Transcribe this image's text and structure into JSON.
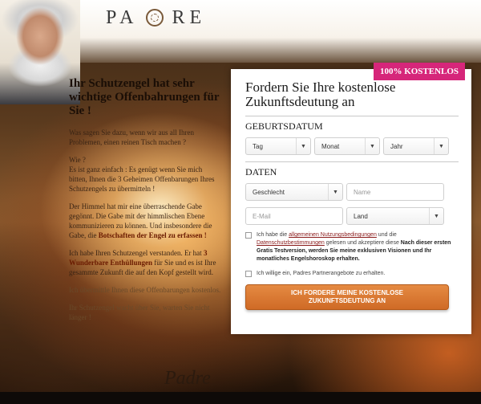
{
  "brand": {
    "logo_text": "PADRE",
    "signature": "Padre"
  },
  "badge": "100% KOSTENLOS",
  "left": {
    "headline": "Ihr Schutzengel hat sehr wichtige Offenbahrungen für Sie !",
    "p1": "Was sagen Sie dazu, wenn wir aus all Ihren Problemen, einen reinen Tisch machen ?",
    "p2a": "Wie ?",
    "p2b": "Es ist ganz einfach :  Es genügt wenn Sie mich bitten, Ihnen die 3 Geheimen Offenbarungen Ihres Schutzengels zu übermitteln !",
    "p3a": "Der Himmel hat mir eine überraschende Gabe gegönnt. Die Gabe mit der himmlischen Ebene kommunizieren zu können. Und insbesondere die Gabe, die ",
    "p3b": "Botschaften der Engel zu erfassen !",
    "p4a": "Ich habe Ihren Schutzengel verstanden. Er hat ",
    "p4b": "3 Wunderbare Enthüllungen",
    "p4c": " für Sie und es ist Ihre gesammte Zukunft die auf den Kopf gestellt wird.",
    "p5": "Ich übermittle Ihnen diese Offenbarungen kostenlos.",
    "p6": "Ihr Schutzengel wacht über Sie, warten Sie nicht länger !"
  },
  "form": {
    "title": "Fordern Sie Ihre kostenlose Zukunftsdeutung an",
    "birth_label": "GEBURTSDATUM",
    "day": "Tag",
    "month": "Monat",
    "year": "Jahr",
    "data_label": "DATEN",
    "gender": "Geschlecht",
    "name_placeholder": "Name",
    "email_placeholder": "E-Mail",
    "country": "Land",
    "terms_1": "Ich habe die ",
    "terms_link1": "allgemeinen Nutzungsbedingungen",
    "terms_2": " und die ",
    "terms_link2": "Datenschutzbestimmungen",
    "terms_3": " gelesen und akzeptiere diese ",
    "terms_bold": "Nach dieser ersten Gratis Testversion, werden Sie meine exklusiven Visionen und Ihr monatliches Engelshoroskop erhalten.",
    "partner": "Ich willige ein, Padres Partnerangebote zu erhalten.",
    "cta": "ICH FORDERE MEINE KOSTENLOSE ZUKUNFTSDEUTUNG AN"
  },
  "colors": {
    "badge": "#d6267a",
    "cta": "#e58a42",
    "link": "#8a1a1a"
  },
  "icons": {
    "caret": "chevron-down-icon",
    "logo": "mandala-icon"
  }
}
